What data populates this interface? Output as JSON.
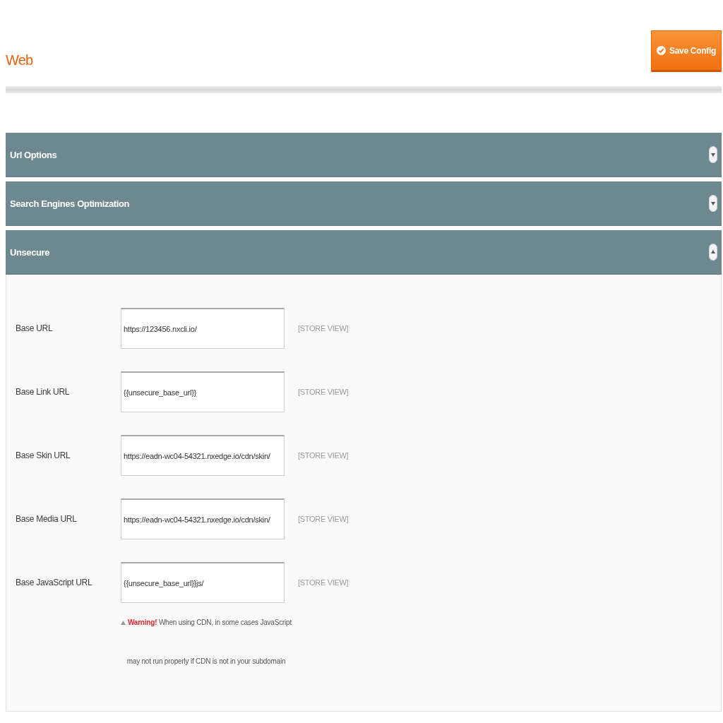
{
  "header": {
    "title": "Web",
    "save_button": "Save Config"
  },
  "sections": [
    {
      "title": "Url Options",
      "expanded": false
    },
    {
      "title": "Search Engines Optimization",
      "expanded": false
    },
    {
      "title": "Unsecure",
      "expanded": true,
      "fields": [
        {
          "label": "Base URL",
          "value": "https://123456.nxcli.io/",
          "scope": "[STORE VIEW]"
        },
        {
          "label": "Base Link URL",
          "value": "{{unsecure_base_url}}",
          "scope": "[STORE VIEW]"
        },
        {
          "label": "Base Skin URL",
          "value": "https://eadn-wc04-54321.nxedge.io/cdn/skin/",
          "scope": "[STORE VIEW]"
        },
        {
          "label": "Base Media URL",
          "value": "https://eadn-wc04-54321.nxedge.io/cdn/skin/",
          "scope": "[STORE VIEW]"
        },
        {
          "label": "Base JavaScript URL",
          "value": "{{unsecure_base_url}}js/",
          "scope": "[STORE VIEW]",
          "note": "**Warning!** When using CDN, in some cases JavaScript may not run properly if CDN is not in your subdomain"
        }
      ]
    }
  ]
}
